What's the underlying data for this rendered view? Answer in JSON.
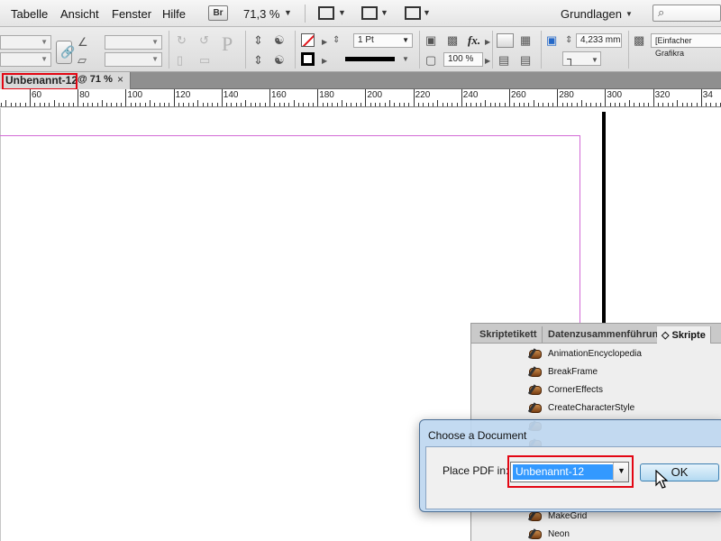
{
  "menubar": {
    "items": [
      "Tabelle",
      "Ansicht",
      "Fenster",
      "Hilfe"
    ],
    "bridge_label": "Br",
    "zoom": "71,3 %",
    "workspace": "Grundlagen",
    "search_icon": "⌕"
  },
  "control_panel": {
    "stroke_weight": "1 Pt",
    "dimension": "4,233 mm",
    "scale": "100 %",
    "object_style": "[Einfacher Grafikra",
    "paragraph_glyph": "P",
    "fx_label": "fx."
  },
  "document_tab": {
    "name": "Unbenannt-12",
    "zoom": "@ 71 %",
    "close": "×"
  },
  "ruler": {
    "labels": [
      "60",
      "80",
      "100",
      "120",
      "140",
      "160",
      "180",
      "200",
      "220",
      "240",
      "260",
      "280",
      "300",
      "320",
      "34"
    ]
  },
  "scripts_panel": {
    "tabs": [
      "Skriptetikett",
      "Datenzusammenführung",
      "◇ Skripte"
    ],
    "scripts": [
      "AnimationEncyclopedia",
      "BreakFrame",
      "CornerEffects",
      "CreateCharacterStyle",
      "",
      "",
      "",
      "",
      "",
      "MakeGrid",
      "Neon"
    ]
  },
  "dialog": {
    "title": "Choose a Document",
    "place_label": "Place PDF in:",
    "selected_document": "Unbenannt-12",
    "ok_label": "OK"
  },
  "colors": {
    "highlight_red": "#e30613",
    "selection_blue": "#3399ff",
    "margin_guide": "#d36ad6"
  }
}
